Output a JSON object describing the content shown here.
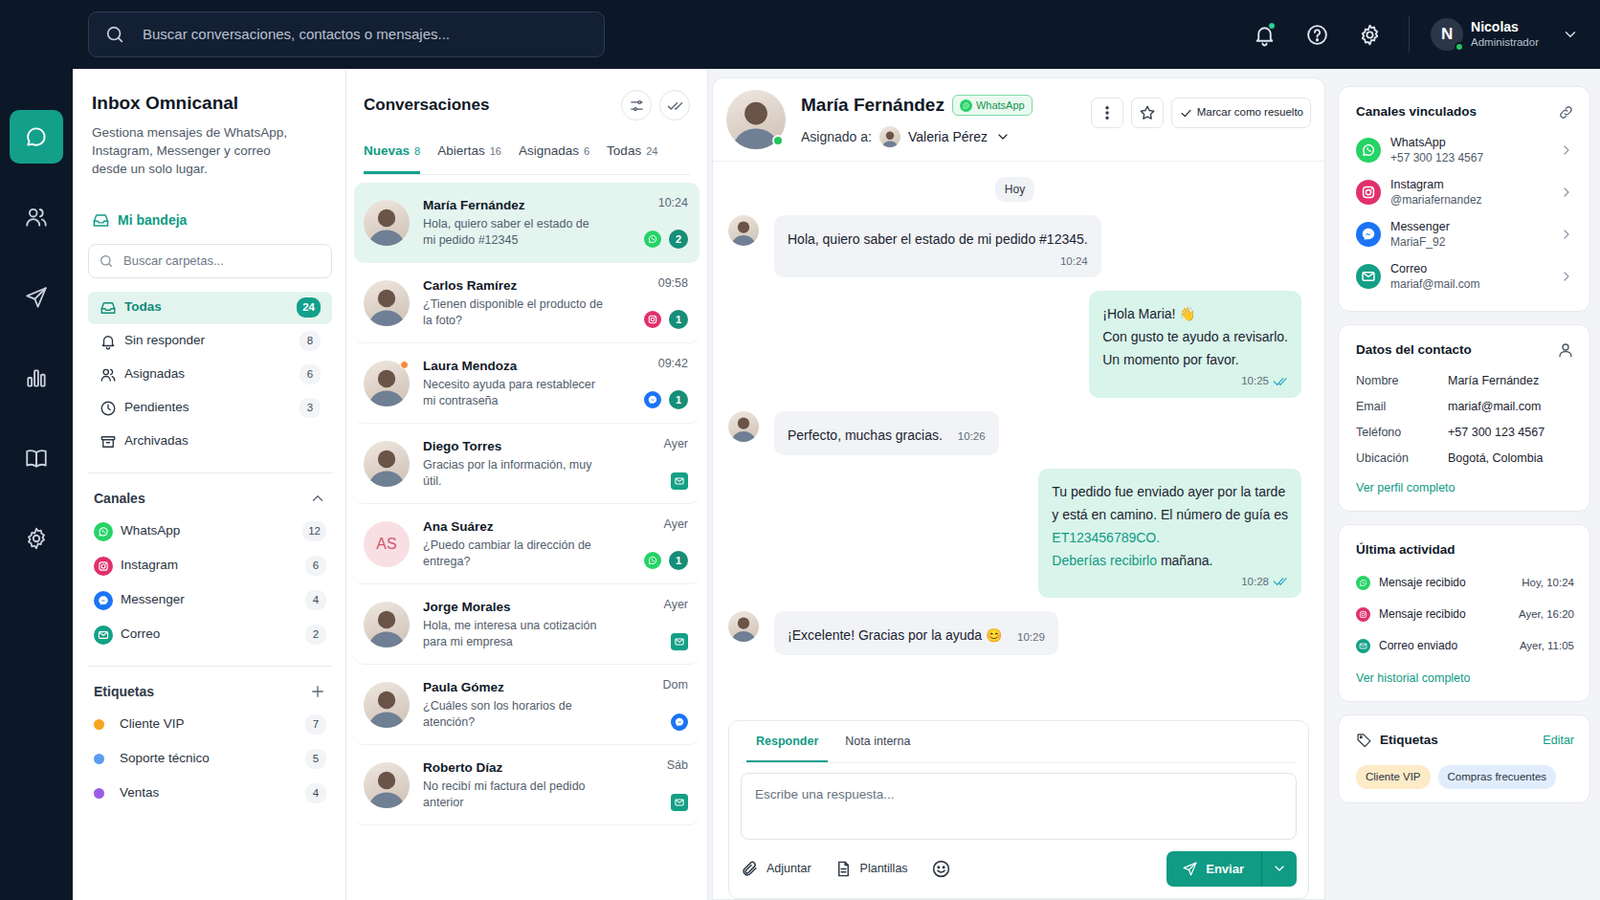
{
  "topbar": {
    "search": {
      "placeholder": "Buscar conversaciones, contactos o mensajes..."
    },
    "notifications": {
      "unread": true
    },
    "user": {
      "initial": "N",
      "name": "Nicolas",
      "role": "Administrador",
      "online": true
    }
  },
  "rail": [
    {
      "kind": "chat",
      "selected": true
    },
    {
      "kind": "contacts",
      "selected": false
    },
    {
      "kind": "campaigns",
      "selected": false
    },
    {
      "kind": "reports",
      "selected": false
    },
    {
      "kind": "knowledge",
      "selected": false
    },
    {
      "kind": "settings",
      "selected": false
    }
  ],
  "sidebar": {
    "title": "Inbox Omnicanal",
    "description": "Gestiona mensajes de WhatsApp, Instagram, Messenger y correo desde un solo lugar.",
    "inbox": "Mi bandeja",
    "folder_search": {
      "placeholder": "Buscar carpetas..."
    },
    "folders": [
      {
        "label": "Todas",
        "count": "24",
        "kind": "all",
        "selected": true
      },
      {
        "label": "Sin responder",
        "count": "8",
        "kind": "unanswered",
        "selected": false
      },
      {
        "label": "Asignadas",
        "count": "6",
        "kind": "assigned",
        "selected": false
      },
      {
        "label": "Pendientes",
        "count": "3",
        "kind": "pending",
        "selected": false
      },
      {
        "label": "Archivadas",
        "kind": "archived",
        "selected": false
      }
    ],
    "channels_title": "Canales",
    "channels_expanded": true,
    "channels": [
      {
        "label": "WhatsApp",
        "count": "12",
        "kind": "whatsapp"
      },
      {
        "label": "Instagram",
        "count": "6",
        "kind": "instagram"
      },
      {
        "label": "Messenger",
        "count": "4",
        "kind": "messenger"
      },
      {
        "label": "Correo",
        "count": "2",
        "kind": "email"
      }
    ],
    "tags_title": "Etiquetas",
    "tags": [
      {
        "label": "Cliente VIP",
        "count": "7",
        "color": "#f5a623"
      },
      {
        "label": "Soporte técnico",
        "count": "5",
        "color": "#5a9cf2"
      },
      {
        "label": "Ventas",
        "count": "4",
        "color": "#9b5de5"
      }
    ]
  },
  "conversations": {
    "title": "Conversaciones",
    "tabs": [
      {
        "label": "Nuevas",
        "count": "8",
        "selected": true
      },
      {
        "label": "Abiertas",
        "count": "16",
        "selected": false
      },
      {
        "label": "Asignadas",
        "count": "6",
        "selected": false
      },
      {
        "label": "Todas",
        "count": "24",
        "selected": false
      }
    ],
    "items": [
      {
        "name": "María Fernández",
        "preview": "Hola, quiero saber el estado de mi pedido #12345",
        "time": "10:24",
        "channel": "whatsapp",
        "unread": "2",
        "avatar": "photo",
        "alert": false,
        "selected": true
      },
      {
        "name": "Carlos Ramírez",
        "preview": "¿Tienen disponible el producto de la foto?",
        "time": "09:58",
        "channel": "instagram",
        "unread": "1",
        "avatar": "photo",
        "alert": false,
        "selected": false
      },
      {
        "name": "Laura Mendoza",
        "preview": "Necesito ayuda para restablecer mi contraseña",
        "time": "09:42",
        "channel": "messenger",
        "unread": "1",
        "avatar": "photo",
        "alert": true,
        "selected": false
      },
      {
        "name": "Diego Torres",
        "preview": "Gracias por la información, muy útil.",
        "time": "Ayer",
        "channel": "email",
        "avatar": "photo",
        "alert": false,
        "selected": false
      },
      {
        "name": "Ana Suárez",
        "initials": "AS",
        "preview": "¿Puedo cambiar la dirección de entrega?",
        "time": "Ayer",
        "channel": "whatsapp",
        "unread": "1",
        "avatar": "initials",
        "alert": false,
        "selected": false
      },
      {
        "name": "Jorge Morales",
        "preview": "Hola, me interesa una cotización para mi empresa",
        "time": "Ayer",
        "channel": "email",
        "avatar": "photo",
        "alert": false,
        "selected": false
      },
      {
        "name": "Paula Gómez",
        "preview": "¿Cuáles son los horarios de atención?",
        "time": "Dom",
        "channel": "messenger",
        "avatar": "photo",
        "alert": false,
        "selected": false
      },
      {
        "name": "Roberto Díaz",
        "preview": "No recibí mi factura del pedido anterior",
        "time": "Sáb",
        "channel": "email",
        "avatar": "photo",
        "alert": false,
        "selected": false
      }
    ]
  },
  "chat": {
    "contact": {
      "name": "María Fernández",
      "channel": "WhatsApp",
      "kind": "whatsapp",
      "online": true
    },
    "assigned_label": "Asignado a:",
    "assignee": "Valeria Pérez",
    "starred": false,
    "resolve": "Marcar como resuelto",
    "day": "Hoy",
    "messages": [
      {
        "kind": "in",
        "lines": [
          [
            {
              "text": "Hola, quiero saber el estado de mi pedido #12345.",
              "link": false
            }
          ]
        ],
        "time": "10:24"
      },
      {
        "kind": "out",
        "lines": [
          [
            {
              "text": "¡Hola Maria! 👋",
              "link": false
            }
          ],
          [
            {
              "text": "Con gusto te ayudo a revisarlo.",
              "link": false
            }
          ],
          [
            {
              "text": "Un momento por favor.",
              "link": false
            }
          ]
        ],
        "time": "10:25",
        "read": true
      },
      {
        "kind": "in",
        "lines": [
          [
            {
              "text": "Perfecto, muchas gracias.",
              "link": false
            }
          ]
        ],
        "time": "10:26"
      },
      {
        "kind": "out",
        "lines": [
          [
            {
              "text": "Tu pedido fue enviado ayer por la tarde",
              "link": false
            }
          ],
          [
            {
              "text": "y está en camino. El número de guía es",
              "link": false
            }
          ],
          [
            {
              "text": "ET123456789CO.",
              "link": true
            }
          ],
          [
            {
              "text": "Deberías recibirlo",
              "link": true
            },
            {
              "text": " mañana.",
              "link": false
            }
          ]
        ],
        "time": "10:28",
        "read": true
      },
      {
        "kind": "in",
        "lines": [
          [
            {
              "text": "¡Excelente! Gracias por la ayuda 😊",
              "link": false
            }
          ]
        ],
        "time": "10:29"
      }
    ]
  },
  "composer": {
    "tabs": [
      {
        "label": "Responder",
        "selected": true
      },
      {
        "label": "Nota interna",
        "selected": false
      }
    ],
    "placeholder": "Escribe una respuesta...",
    "actions": [
      {
        "label": "Adjuntar",
        "kind": "attach"
      },
      {
        "label": "Plantillas",
        "kind": "templates"
      }
    ],
    "send": "Enviar"
  },
  "details": {
    "linked_title": "Canales vinculados",
    "linked": [
      {
        "channel": "WhatsApp",
        "handle": "+57 300 123 4567",
        "kind": "whatsapp"
      },
      {
        "channel": "Instagram",
        "handle": "@mariafernandez",
        "kind": "instagram"
      },
      {
        "channel": "Messenger",
        "handle": "MariaF_92",
        "kind": "messenger"
      },
      {
        "channel": "Correo",
        "handle": "mariaf@mail.com",
        "kind": "email"
      }
    ],
    "contact_title": "Datos del contacto",
    "fields": [
      {
        "label": "Nombre",
        "value": "María Fernández"
      },
      {
        "label": "Email",
        "value": "mariaf@mail.com"
      },
      {
        "label": "Teléfono",
        "value": "+57 300 123 4567"
      },
      {
        "label": "Ubicación",
        "value": "Bogotá, Colombia"
      }
    ],
    "profile_link": "Ver perfil completo",
    "activity_title": "Última actividad",
    "activity": [
      {
        "label": "Mensaje recibido",
        "time": "Hoy, 10:24",
        "kind": "whatsapp"
      },
      {
        "label": "Mensaje recibido",
        "time": "Ayer, 16:20",
        "kind": "instagram"
      },
      {
        "label": "Correo enviado",
        "time": "Ayer, 11:05",
        "kind": "email"
      }
    ],
    "history_link": "Ver historial completo",
    "tags_title": "Etiquetas",
    "tags_edit": "Editar",
    "tags": [
      {
        "label": "Cliente VIP",
        "color": "#fdebc8"
      },
      {
        "label": "Compras frecuentes",
        "color": "#e1edfd"
      }
    ]
  }
}
